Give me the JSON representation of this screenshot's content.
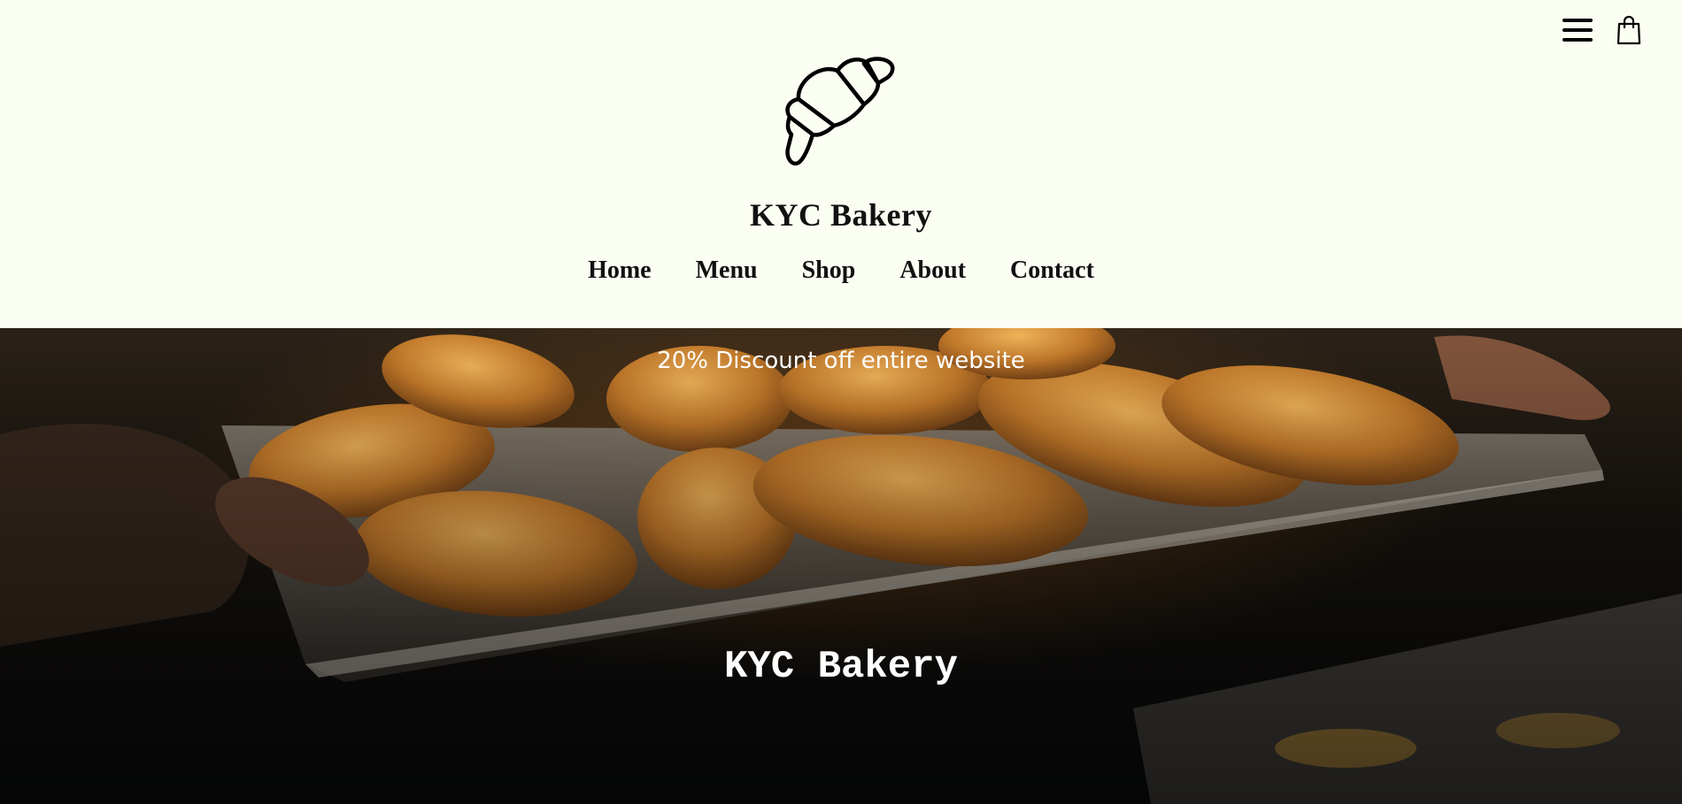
{
  "header": {
    "brand_name": "KYC Bakery",
    "logo_icon": "croissant-icon",
    "menu_icon": "hamburger-menu-icon",
    "cart_icon": "shopping-bag-icon"
  },
  "nav": {
    "items": [
      {
        "label": "Home"
      },
      {
        "label": "Menu"
      },
      {
        "label": "Shop"
      },
      {
        "label": "About"
      },
      {
        "label": "Contact"
      }
    ]
  },
  "hero": {
    "banner_text": "20% Discount off entire website",
    "title": "KYC Bakery"
  },
  "colors": {
    "background": "#fbfef3",
    "text": "#111111",
    "hero_text": "#ffffff"
  }
}
